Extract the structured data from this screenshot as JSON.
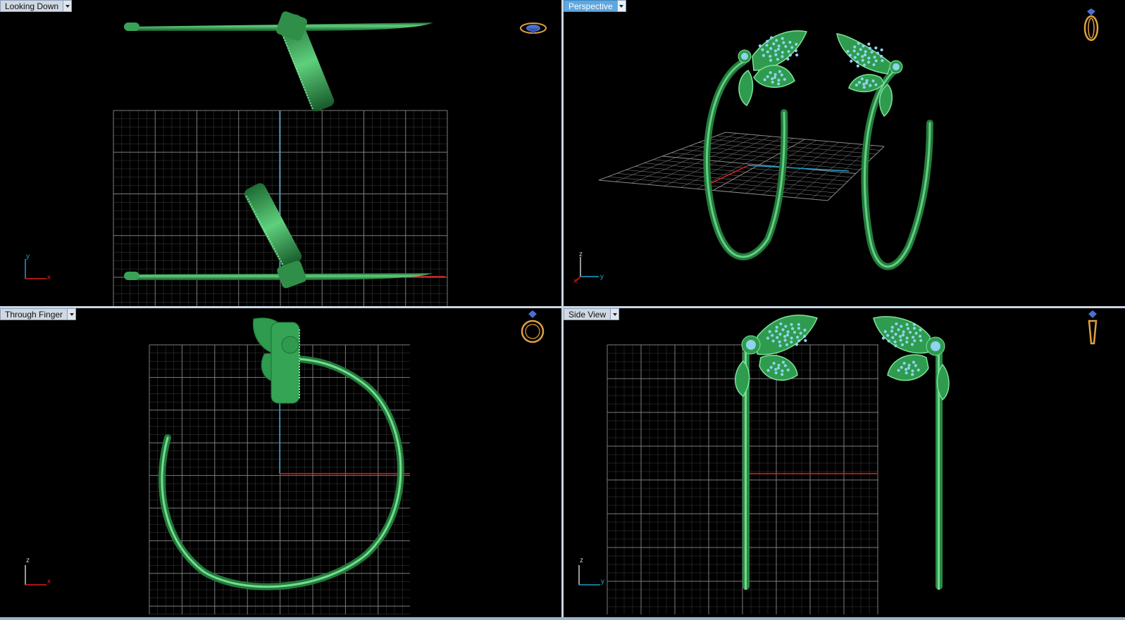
{
  "viewports": {
    "top_left": {
      "label": "Looking Down",
      "axis_a": "y",
      "axis_b": "x"
    },
    "top_right": {
      "label": "Perspective",
      "axis_a": "z",
      "axis_b": "y",
      "axis_c": "x"
    },
    "bottom_left": {
      "label": "Through Finger",
      "axis_a": "z",
      "axis_b": "x"
    },
    "bottom_right": {
      "label": "Side View",
      "axis_a": "z",
      "axis_b": "y"
    }
  },
  "active_viewport": "Perspective",
  "colors": {
    "background": "#000000",
    "grid": "#8a8a8a",
    "model": "#2e9b4e",
    "axis_x": "#e02020",
    "axis_y": "#1ea0c8",
    "axis_z": "#cccccc",
    "gems": "#8fd3ee",
    "view_icon": "#e0a040"
  },
  "icons": {
    "view_cube_top": "ring-top-view-icon",
    "view_cube_perspective": "ring-perspective-icon",
    "view_cube_finger": "ring-front-view-icon",
    "view_cube_side": "ring-side-view-icon"
  }
}
